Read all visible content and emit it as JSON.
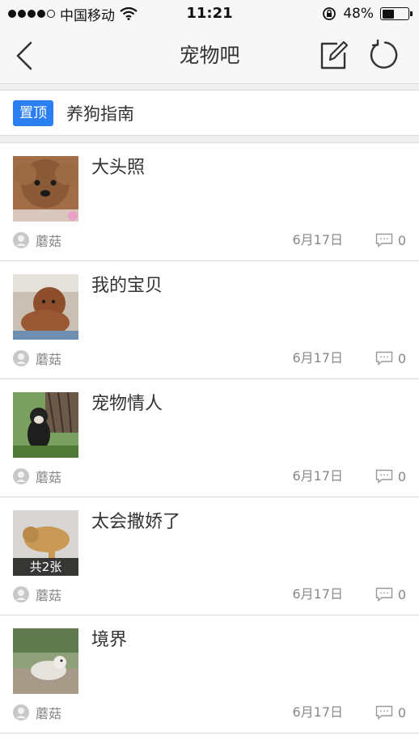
{
  "status": {
    "carrier": "中国移动",
    "time": "11:21",
    "battery": "48%",
    "battery_level": 0.48
  },
  "nav": {
    "title": "宠物吧",
    "back_icon": "chevron-left-icon",
    "edit_icon": "compose-icon",
    "refresh_icon": "refresh-icon"
  },
  "pinned": {
    "badge": "置顶",
    "title": "养狗指南"
  },
  "posts": [
    {
      "title": "大头照",
      "author": "蘑菇",
      "date": "6月17日",
      "comments": "0",
      "photo_count": ""
    },
    {
      "title": "我的宝贝",
      "author": "蘑菇",
      "date": "6月17日",
      "comments": "0",
      "photo_count": ""
    },
    {
      "title": "宠物情人",
      "author": "蘑菇",
      "date": "6月17日",
      "comments": "0",
      "photo_count": ""
    },
    {
      "title": "太会撒娇了",
      "author": "蘑菇",
      "date": "6月17日",
      "comments": "0",
      "photo_count": "共2张"
    },
    {
      "title": "境界",
      "author": "蘑菇",
      "date": "6月17日",
      "comments": "0",
      "photo_count": ""
    }
  ],
  "colors": {
    "accent": "#2b7ff0",
    "nav_bg": "#f7f7f7",
    "meta_text": "#888888"
  }
}
